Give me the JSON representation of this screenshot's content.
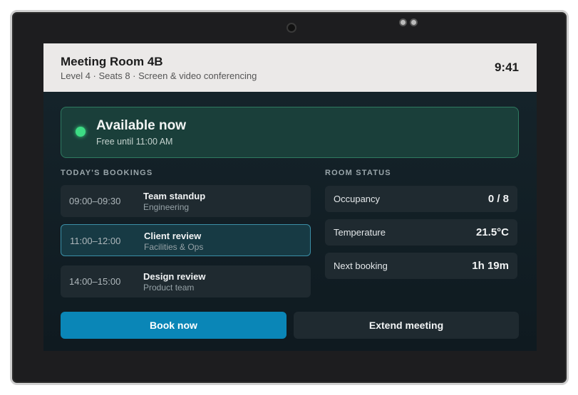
{
  "header": {
    "room_name": "Meeting Room 4B",
    "details": "Level 4 · Seats 8 · Screen & video conferencing",
    "time": "9:41"
  },
  "status": {
    "title": "Available now",
    "subtitle": "Free until 11:00 AM",
    "color": "#3ddc84"
  },
  "bookings": {
    "label": "TODAY'S BOOKINGS",
    "items": [
      {
        "time": "09:00–09:30",
        "title": "Team standup",
        "org": "Engineering"
      },
      {
        "time": "11:00–12:00",
        "title": "Client review",
        "org": "Facilities & Ops"
      },
      {
        "time": "14:00–15:00",
        "title": "Design review",
        "org": "Product team"
      }
    ]
  },
  "room_status": {
    "label": "ROOM STATUS",
    "items": [
      {
        "label": "Occupancy",
        "value": "0 / 8"
      },
      {
        "label": "Temperature",
        "value": "21.5°C"
      },
      {
        "label": "Next booking",
        "value": "1h 19m"
      }
    ]
  },
  "actions": {
    "book_label": "Book now",
    "extend_label": "Extend meeting",
    "accent": "#0a86b7"
  }
}
